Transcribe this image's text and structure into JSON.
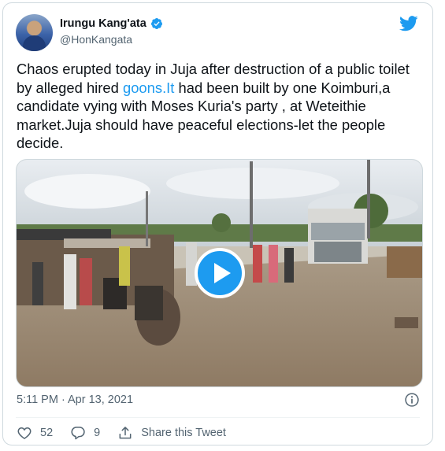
{
  "author": {
    "display_name": "Irungu Kang'ata",
    "handle": "@HonKangata",
    "verified": true
  },
  "tweet": {
    "text_before_link": "Chaos erupted today in Juja after destruction of a public toilet by alleged hired ",
    "link_text": "goons.It",
    "text_after_link": " had been  built by one Koimburi,a candidate vying with Moses Kuria's party , at Weteithie market.Juja should have peaceful elections-let the people decide.",
    "timestamp": "5:11 PM · Apr 13, 2021"
  },
  "actions": {
    "likes": "52",
    "replies": "9",
    "share_label": "Share this Tweet"
  },
  "icons": {
    "brand": "twitter-bird-icon",
    "verified": "verified-badge-icon",
    "info": "info-icon",
    "like": "heart-icon",
    "reply": "reply-bubble-icon",
    "share": "share-icon",
    "play": "play-icon"
  },
  "colors": {
    "brand_blue": "#1d9bf0",
    "text_primary": "#0f1419",
    "text_secondary": "#536471",
    "border": "#cfd9de"
  }
}
